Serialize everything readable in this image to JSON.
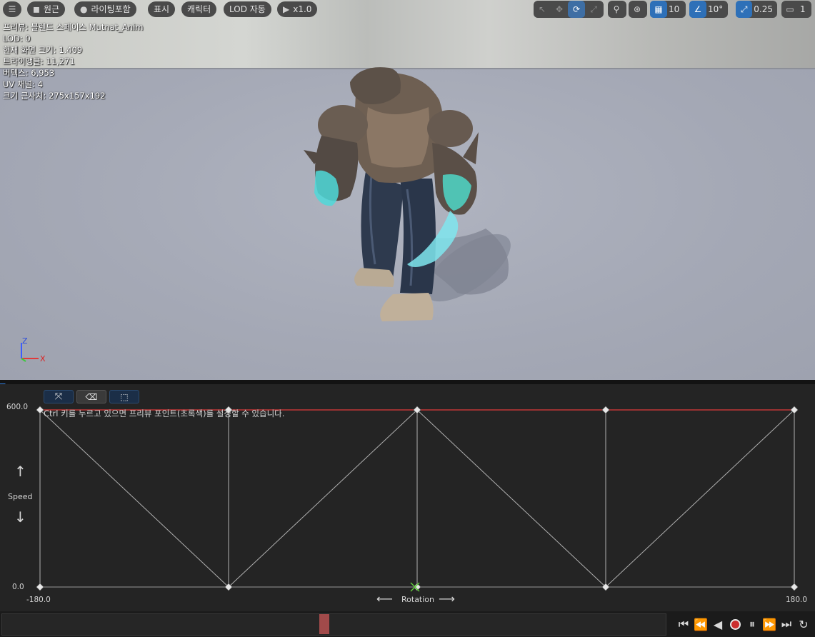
{
  "toolbar": {
    "menu_icon": "hamburger-icon",
    "perspective_label": "원근",
    "lighting_label": "라이팅포함",
    "show_label": "표시",
    "character_label": "캐릭터",
    "lod_label": "LOD 자동",
    "play_speed_label": "x1.0",
    "grid_snap_value": "10",
    "rotation_snap_value": "10°",
    "scale_snap_value": "0.25",
    "camera_speed_value": "1"
  },
  "stats": {
    "preview": "프리뷰: 블렌드 스페이스 Mutnat_Anim",
    "lod": "LOD: 0",
    "screen_size": "현재 화면 크기: 1.409",
    "triangles": "트라이앵글: 11,271",
    "vertices": "버텍스: 6,953",
    "uv_channels": "UV 채널: 4",
    "approx_size": "크기 근사치: 275x157x192"
  },
  "axis_gizmo": {
    "z_label": "Z",
    "x_label": "X"
  },
  "blendspace": {
    "hint": "Ctrl 키를 누르고 있으면 프리뷰 포인트(초록색)를 설정할 수 있습니다.",
    "y_axis_name": "Speed",
    "y_max_label": "600.0",
    "y_min_label": "0.0",
    "x_axis_name": "Rotation",
    "x_min_label": "-180.0",
    "x_max_label": "180.0",
    "x_range": [
      -180,
      180
    ],
    "y_range": [
      0,
      600
    ],
    "sample_points": [
      {
        "x": -180,
        "y": 600
      },
      {
        "x": -90,
        "y": 600
      },
      {
        "x": 0,
        "y": 600
      },
      {
        "x": 90,
        "y": 600
      },
      {
        "x": 180,
        "y": 600
      },
      {
        "x": -180,
        "y": 0
      },
      {
        "x": -90,
        "y": 0
      },
      {
        "x": 0,
        "y": 0
      },
      {
        "x": 90,
        "y": 0
      },
      {
        "x": 180,
        "y": 0
      }
    ],
    "preview_point": {
      "x": 0,
      "y": 0
    },
    "colors": {
      "grid_line": "#c8c8c8",
      "preview_line": "#e03a3a",
      "preview_point": "#5ec83a",
      "background": "#242424"
    }
  },
  "transport": {
    "scrub_fraction": 0.485,
    "controls": [
      "skip-to-start-icon",
      "step-back-icon",
      "play-reverse-icon",
      "record-icon",
      "pause-icon",
      "step-forward-icon",
      "skip-to-end-icon",
      "loop-icon"
    ]
  }
}
